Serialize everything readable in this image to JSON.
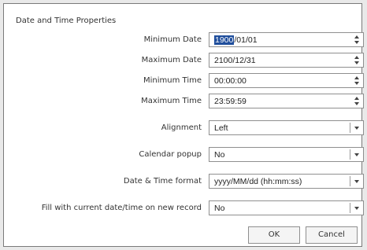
{
  "dialog": {
    "title": "Date and Time Properties",
    "rows": [
      {
        "label": "Minimum Date",
        "value_selected": "1900",
        "value_rest": "/01/01",
        "control": "spinner"
      },
      {
        "label": "Maximum Date",
        "value": "2100/12/31",
        "control": "spinner"
      },
      {
        "label": "Minimum Time",
        "value": "00:00:00",
        "control": "spinner"
      },
      {
        "label": "Maximum Time",
        "value": "23:59:59",
        "control": "spinner"
      },
      {
        "label": "Alignment",
        "value": "Left",
        "control": "dropdown"
      },
      {
        "label": "Calendar popup",
        "value": "No",
        "control": "dropdown"
      },
      {
        "label": "Date & Time format",
        "value": "yyyy/MM/dd (hh:mm:ss)",
        "control": "dropdown"
      },
      {
        "label": "Fill with current date/time on new record",
        "value": "No",
        "control": "dropdown"
      }
    ],
    "ok_label": "OK",
    "cancel_label": "Cancel"
  },
  "colors": {
    "selection": "#1f4e9c",
    "border": "#8f8f8f",
    "background": "#ffffff"
  },
  "icons": {
    "spinner": "spinner-arrows-icon",
    "dropdown": "chevron-down-icon"
  }
}
